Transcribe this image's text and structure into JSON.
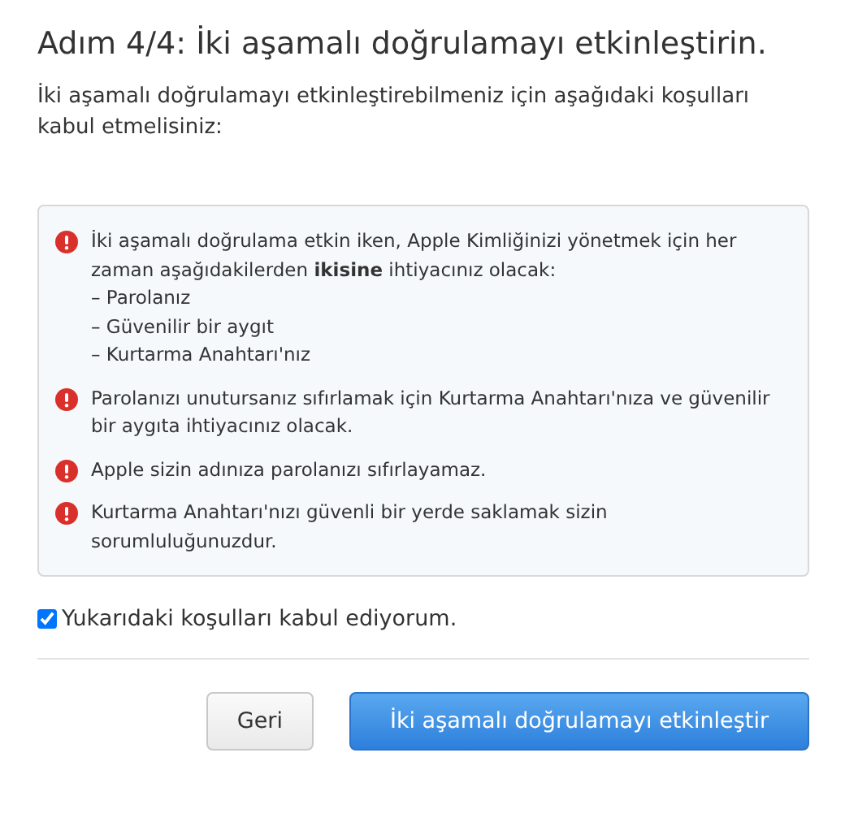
{
  "title": "Adım 4/4: İki aşamalı doğrulamayı etkinleştirin.",
  "intro": "İki aşamalı doğrulamayı etkinleştirebilmeniz için aşağıdaki koşulları kabul etmelisiniz:",
  "warnings": [
    {
      "text": "İki aşamalı doğrulama etkin iken, Apple Kimliğinizi yönetmek için her zaman aşağıdakilerden **ikisine** ihtiyacınız olacak:",
      "list": [
        "– Parolanız",
        "– Güvenilir bir aygıt",
        "– Kurtarma Anahtarı'nız"
      ]
    },
    {
      "text": "Parolanızı unutursanız sıfırlamak için Kurtarma Anahtarı'nıza ve güvenilir bir aygıta ihtiyacınız olacak."
    },
    {
      "text": "Apple sizin adınıza parolanızı sıfırlayamaz."
    },
    {
      "text": "Kurtarma Anahtarı'nızı güvenli bir yerde saklamak sizin sorumluluğunuzdur."
    }
  ],
  "agree": {
    "label": "Yukarıdaki koşulları kabul ediyorum.",
    "checked": true
  },
  "buttons": [
    {
      "label": "Geri",
      "kind": "secondary"
    },
    {
      "label": "İki aşamalı doğrulamayı etkinleştir",
      "kind": "primary"
    }
  ]
}
